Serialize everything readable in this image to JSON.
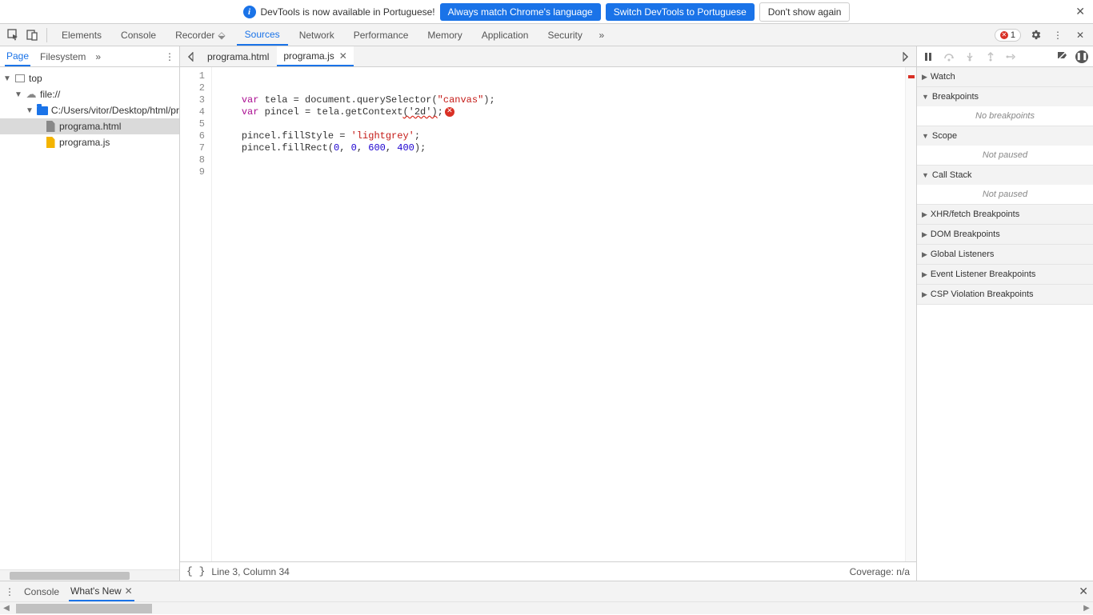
{
  "infobar": {
    "message": "DevTools is now available in Portuguese!",
    "btn_match": "Always match Chrome's language",
    "btn_switch": "Switch DevTools to Portuguese",
    "btn_dismiss": "Don't show again"
  },
  "mainTabs": {
    "items": [
      "Elements",
      "Console",
      "Recorder",
      "Sources",
      "Network",
      "Performance",
      "Memory",
      "Application",
      "Security"
    ],
    "active": "Sources",
    "errorCount": "1"
  },
  "leftPanel": {
    "tabs": [
      "Page",
      "Filesystem"
    ],
    "active": "Page",
    "tree": {
      "top": "top",
      "origin": "file://",
      "folder": "C:/Users/vitor/Desktop/html/programa",
      "files": [
        "programa.html",
        "programa.js"
      ],
      "selected": "programa.html"
    }
  },
  "editor": {
    "tabs": [
      {
        "name": "programa.html",
        "active": false
      },
      {
        "name": "programa.js",
        "active": true
      }
    ],
    "lineCount": 9,
    "code": {
      "l2a": "var",
      "l2b": " tela = document.querySelector(",
      "l2c": "\"canvas\"",
      "l2d": ");",
      "l3a": "var",
      "l3b": " pincel = tela.getContext",
      "l3c": "('2d')",
      "l3d": ";",
      "l5a": "pincel.fillStyle = ",
      "l5b": "'lightgrey'",
      "l5c": ";",
      "l6a": "pincel.fillRect(",
      "l6b": "0",
      "l6c": ", ",
      "l6d": "0",
      "l6e": ", ",
      "l6f": "600",
      "l6g": ", ",
      "l6h": "400",
      "l6i": ");"
    },
    "status": {
      "pos": "Line 3, Column 34",
      "coverage": "Coverage: n/a"
    }
  },
  "debugger": {
    "sections": [
      {
        "title": "Watch",
        "open": true,
        "collapsedArrow": "▶"
      },
      {
        "title": "Breakpoints",
        "open": true,
        "body": "No breakpoints",
        "collapsedArrow": "▼"
      },
      {
        "title": "Scope",
        "open": true,
        "body": "Not paused",
        "collapsedArrow": "▼"
      },
      {
        "title": "Call Stack",
        "open": true,
        "body": "Not paused",
        "collapsedArrow": "▼"
      },
      {
        "title": "XHR/fetch Breakpoints",
        "open": false,
        "collapsedArrow": "▶"
      },
      {
        "title": "DOM Breakpoints",
        "open": false,
        "collapsedArrow": "▶"
      },
      {
        "title": "Global Listeners",
        "open": false,
        "collapsedArrow": "▶"
      },
      {
        "title": "Event Listener Breakpoints",
        "open": false,
        "collapsedArrow": "▶"
      },
      {
        "title": "CSP Violation Breakpoints",
        "open": false,
        "collapsedArrow": "▶"
      }
    ]
  },
  "drawer": {
    "tabs": [
      {
        "name": "Console",
        "active": false
      },
      {
        "name": "What's New",
        "active": true
      }
    ]
  }
}
